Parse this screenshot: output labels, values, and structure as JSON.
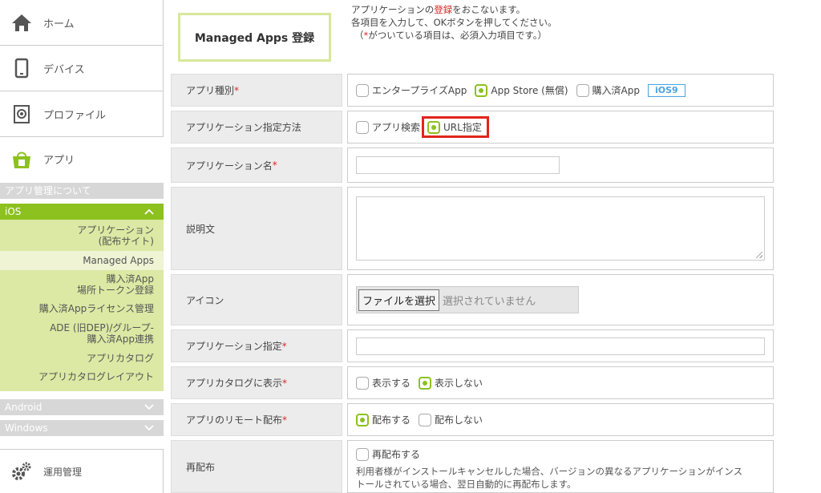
{
  "sidebar": {
    "nav": [
      {
        "label": "ホーム",
        "icon": "home-icon"
      },
      {
        "label": "デバイス",
        "icon": "device-icon"
      },
      {
        "label": "プロファイル",
        "icon": "profile-icon"
      },
      {
        "label": "アプリ",
        "icon": "app-icon"
      }
    ],
    "app_about": "アプリ管理について",
    "ios_label": "iOS",
    "ios_items": [
      {
        "line1": "アプリケーション",
        "line2": "(配布サイト)"
      },
      {
        "line1": "Managed Apps",
        "line2": ""
      },
      {
        "line1": "購入済App",
        "line2": "場所トークン登録"
      },
      {
        "line1": "購入済Appライセンス管理",
        "line2": ""
      },
      {
        "line1": "ADE (旧DEP)/グループ-",
        "line2": "購入済App連携"
      },
      {
        "line1": "アプリカタログ",
        "line2": ""
      },
      {
        "line1": "アプリカタログレイアウト",
        "line2": ""
      }
    ],
    "android_label": "Android",
    "windows_label": "Windows",
    "ops_label": "運用管理"
  },
  "header": {
    "title": "Managed Apps 登録",
    "intro_line1_pre": "アプリケーションの",
    "intro_line1_red": "登録",
    "intro_line1_post": "をおこないます。",
    "intro_line2": "各項目を入力して、OKボタンを押してください。",
    "intro_line3_pre": "（",
    "intro_line3_red": "*",
    "intro_line3_post": "がついている項目は、必須入力項目です。）"
  },
  "form": {
    "app_type": {
      "label": "アプリ種別",
      "required": "*",
      "opt1": "エンタープライズApp",
      "opt2": "App Store (無償)",
      "opt3": "購入済App",
      "badge": "iOS9"
    },
    "method": {
      "label": "アプリケーション指定方法",
      "opt1": "アプリ検索",
      "opt2": "URL指定"
    },
    "app_name": {
      "label": "アプリケーション名",
      "required": "*"
    },
    "description": {
      "label": "説明文"
    },
    "icon": {
      "label": "アイコン",
      "button": "ファイルを選択",
      "status": "選択されていません"
    },
    "app_spec": {
      "label": "アプリケーション指定",
      "required": "*"
    },
    "catalog": {
      "label": "アプリカタログに表示",
      "required": "*",
      "opt1": "表示する",
      "opt2": "表示しない"
    },
    "remote": {
      "label": "アプリのリモート配布",
      "required": "*",
      "opt1": "配布する",
      "opt2": "配布しない"
    },
    "redistribute": {
      "label": "再配布",
      "opt1": "再配布する",
      "desc1": "利用者様がインストールキャンセルした場合、バージョンの異なるアプリケーションがインス",
      "desc2": "トールされている場合、翌日自動的に再配布します。"
    }
  },
  "colors": {
    "accent": "#8cc11f",
    "required": "#d42b2b",
    "highlight": "#e0251b",
    "badge": "#4aa3df"
  }
}
